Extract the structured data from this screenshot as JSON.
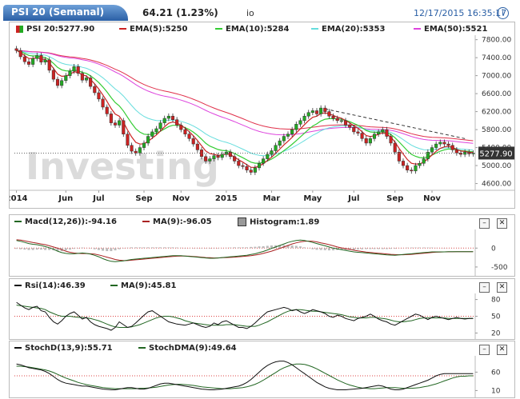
{
  "header": {
    "tab_label": "PSI 20 (Semanal)",
    "quote": "64.21 (1.23%)",
    "symbol_extra": "io",
    "timestamp": "12/17/2015 16:35:17",
    "info_icon": "info-icon"
  },
  "watermark": "Investing",
  "colors": {
    "up": "#22aa22",
    "down": "#cc2222",
    "ema5": "#cc2222",
    "ema10": "#33cc33",
    "ema20": "#66dddd",
    "ema50": "#dd44dd",
    "ema200": "#e0304a"
  },
  "price_panel": {
    "legend": [
      {
        "label": "PSI 20:5277.90",
        "color": "#cc2222",
        "icon": "candlestick-icon"
      },
      {
        "label": "EMA(5):5250",
        "color": "#cc2222"
      },
      {
        "label": "EMA(10):5284",
        "color": "#33cc33"
      },
      {
        "label": "EMA(20):5353",
        "color": "#66dddd"
      },
      {
        "label": "EMA(50):5521",
        "color": "#dd44dd"
      }
    ],
    "last_price_label": "5277.90"
  },
  "macd_panel": {
    "legend": [
      {
        "label": "Macd(12,26)):-94.16",
        "color": "#226622"
      },
      {
        "label": "MA(9):-96.05",
        "color": "#aa2222"
      },
      {
        "label": "Histogram:1.89",
        "color": "#999999"
      }
    ]
  },
  "rsi_panel": {
    "legend": [
      {
        "label": "Rsi(14):46.39",
        "color": "#111111"
      },
      {
        "label": "MA(9):45.81",
        "color": "#226622"
      }
    ]
  },
  "stoch_panel": {
    "legend": [
      {
        "label": "StochD(13,9):55.71",
        "color": "#111111"
      },
      {
        "label": "StochDMA(9):49.64",
        "color": "#226622"
      }
    ]
  },
  "panel_buttons": {
    "minimize": "–",
    "close": "✕"
  },
  "chart_data": [
    {
      "type": "candlestick",
      "title": "PSI 20 (Semanal)",
      "x_ticks": [
        "2014",
        "Jun",
        "Jul",
        "Sep",
        "Nov",
        "2015",
        "Mar",
        "May",
        "Jul",
        "Sep",
        "Nov"
      ],
      "y_ticks": [
        4600,
        5000,
        5400,
        5800,
        6200,
        6600,
        7000,
        7400,
        7800
      ],
      "ylim": [
        4450,
        7900
      ],
      "close": [
        7560,
        7420,
        7310,
        7250,
        7380,
        7450,
        7300,
        7350,
        7120,
        6920,
        6780,
        6890,
        7000,
        7100,
        7200,
        7050,
        6900,
        6950,
        6760,
        6620,
        6480,
        6300,
        6150,
        5950,
        5900,
        6000,
        5700,
        5450,
        5320,
        5280,
        5400,
        5500,
        5650,
        5750,
        5820,
        5950,
        6050,
        6100,
        6020,
        5900,
        5800,
        5700,
        5600,
        5480,
        5350,
        5200,
        5100,
        5150,
        5220,
        5180,
        5250,
        5300,
        5200,
        5100,
        5000,
        4980,
        4900,
        4850,
        4950,
        5050,
        5150,
        5250,
        5330,
        5450,
        5550,
        5650,
        5700,
        5800,
        5920,
        6000,
        6100,
        6180,
        6220,
        6150,
        6280,
        6200,
        6100,
        6050,
        6000,
        6000,
        5900,
        5850,
        5750,
        5720,
        5600,
        5500,
        5600,
        5700,
        5750,
        5800,
        5650,
        5500,
        5300,
        5100,
        5000,
        4900,
        4880,
        5000,
        5050,
        5150,
        5300,
        5400,
        5480,
        5520,
        5480,
        5450,
        5350,
        5280,
        5250,
        5300,
        5260,
        5278
      ],
      "open": [
        7600,
        7560,
        7420,
        7310,
        7250,
        7380,
        7450,
        7300,
        7350,
        7120,
        6920,
        6780,
        6890,
        7000,
        7100,
        7200,
        7050,
        6900,
        6950,
        6760,
        6620,
        6480,
        6300,
        6150,
        5950,
        5900,
        6000,
        5700,
        5450,
        5320,
        5280,
        5400,
        5500,
        5650,
        5750,
        5820,
        5950,
        6050,
        6100,
        6020,
        5900,
        5800,
        5700,
        5600,
        5480,
        5350,
        5200,
        5100,
        5150,
        5220,
        5180,
        5250,
        5300,
        5200,
        5100,
        5000,
        4980,
        4900,
        4850,
        4950,
        5050,
        5150,
        5250,
        5330,
        5450,
        5550,
        5650,
        5700,
        5800,
        5920,
        6000,
        6100,
        6180,
        6220,
        6150,
        6280,
        6200,
        6100,
        6050,
        6000,
        6000,
        5900,
        5850,
        5750,
        5720,
        5600,
        5500,
        5600,
        5700,
        5750,
        5800,
        5650,
        5500,
        5300,
        5100,
        5000,
        4900,
        4880,
        5000,
        5050,
        5150,
        5300,
        5400,
        5480,
        5520,
        5480,
        5450,
        5350,
        5280,
        5250,
        5300,
        5260
      ],
      "series": [
        {
          "name": "EMA(5)",
          "color": "#cc2222"
        },
        {
          "name": "EMA(10)",
          "color": "#33cc33"
        },
        {
          "name": "EMA(20)",
          "color": "#66dddd"
        },
        {
          "name": "EMA(50)",
          "color": "#dd44dd"
        }
      ]
    },
    {
      "type": "line",
      "title": "Macd(12,26))",
      "y_ticks": [
        0,
        -500
      ],
      "ylim": [
        -650,
        450
      ],
      "macd": [
        200,
        180,
        150,
        120,
        100,
        90,
        70,
        40,
        10,
        -30,
        -80,
        -120,
        -140,
        -150,
        -150,
        -140,
        -130,
        -140,
        -160,
        -190,
        -230,
        -280,
        -320,
        -350,
        -360,
        -350,
        -340,
        -320,
        -300,
        -290,
        -280,
        -270,
        -260,
        -250,
        -240,
        -230,
        -220,
        -210,
        -200,
        -200,
        -200,
        -210,
        -220,
        -230,
        -240,
        -250,
        -260,
        -270,
        -270,
        -260,
        -250,
        -240,
        -230,
        -220,
        -210,
        -200,
        -190,
        -170,
        -150,
        -120,
        -90,
        -50,
        -10,
        30,
        70,
        110,
        150,
        180,
        200,
        210,
        200,
        180,
        150,
        120,
        90,
        60,
        30,
        0,
        -20,
        -40,
        -60,
        -80,
        -100,
        -110,
        -120,
        -130,
        -140,
        -150,
        -160,
        -170,
        -180,
        -185,
        -190,
        -180,
        -170,
        -160,
        -150,
        -140,
        -130,
        -120,
        -110,
        -100,
        -100,
        -100,
        -100,
        -95,
        -95,
        -94,
        -94,
        -94,
        -94,
        -94
      ],
      "signal": [
        220,
        210,
        190,
        170,
        150,
        130,
        110,
        90,
        60,
        30,
        0,
        -40,
        -80,
        -110,
        -130,
        -140,
        -145,
        -145,
        -150,
        -160,
        -180,
        -210,
        -240,
        -270,
        -300,
        -320,
        -330,
        -330,
        -320,
        -310,
        -300,
        -290,
        -280,
        -270,
        -260,
        -250,
        -240,
        -230,
        -220,
        -215,
        -210,
        -210,
        -215,
        -220,
        -230,
        -240,
        -250,
        -255,
        -260,
        -260,
        -255,
        -250,
        -245,
        -240,
        -230,
        -220,
        -210,
        -200,
        -185,
        -165,
        -140,
        -110,
        -80,
        -45,
        -10,
        30,
        70,
        110,
        140,
        165,
        180,
        185,
        180,
        165,
        140,
        115,
        90,
        60,
        30,
        5,
        -15,
        -35,
        -55,
        -75,
        -90,
        -105,
        -115,
        -125,
        -135,
        -145,
        -155,
        -165,
        -172,
        -176,
        -176,
        -172,
        -165,
        -155,
        -145,
        -135,
        -125,
        -115,
        -108,
        -104,
        -100,
        -98,
        -97,
        -96,
        -96,
        -96,
        -96,
        -96
      ]
    },
    {
      "type": "line",
      "title": "Rsi(14)",
      "y_ticks": [
        80,
        50,
        20
      ],
      "ylim": [
        15,
        88
      ],
      "rsi": [
        75,
        70,
        65,
        62,
        66,
        68,
        60,
        58,
        48,
        40,
        36,
        42,
        50,
        55,
        58,
        52,
        45,
        48,
        40,
        35,
        32,
        30,
        28,
        25,
        30,
        40,
        35,
        30,
        32,
        38,
        45,
        52,
        58,
        60,
        55,
        50,
        45,
        40,
        38,
        36,
        35,
        34,
        36,
        38,
        35,
        32,
        30,
        32,
        38,
        35,
        40,
        42,
        38,
        34,
        30,
        30,
        28,
        32,
        38,
        45,
        52,
        58,
        60,
        62,
        64,
        66,
        64,
        60,
        62,
        58,
        55,
        58,
        62,
        60,
        58,
        55,
        50,
        48,
        52,
        50,
        46,
        44,
        42,
        46,
        48,
        50,
        54,
        50,
        45,
        42,
        40,
        36,
        34,
        38,
        42,
        46,
        50,
        54,
        52,
        48,
        44,
        48,
        50,
        48,
        46,
        44,
        46,
        48,
        46,
        45,
        46,
        46
      ],
      "ma": [
        70,
        69,
        68,
        67,
        66,
        65,
        64,
        62,
        58,
        55,
        52,
        50,
        50,
        50,
        49,
        48,
        48,
        47,
        46,
        44,
        42,
        39,
        36,
        33,
        31,
        30,
        30,
        30,
        31,
        33,
        35,
        38,
        41,
        44,
        47,
        49,
        50,
        50,
        49,
        47,
        45,
        42,
        40,
        38,
        37,
        36,
        35,
        34,
        34,
        34,
        34,
        35,
        35,
        35,
        34,
        33,
        32,
        32,
        32,
        34,
        37,
        40,
        44,
        48,
        52,
        56,
        59,
        61,
        62,
        62,
        61,
        60,
        59,
        59,
        58,
        57,
        56,
        55,
        54,
        53,
        51,
        49,
        48,
        47,
        47,
        47,
        48,
        48,
        47,
        46,
        45,
        43,
        41,
        40,
        40,
        41,
        42,
        44,
        46,
        47,
        47,
        47,
        47,
        47,
        47,
        46,
        46,
        46,
        46,
        46,
        46,
        46
      ]
    },
    {
      "type": "line",
      "title": "StochD(13,9)",
      "y_ticks": [
        60,
        10
      ],
      "ylim": [
        0,
        100
      ],
      "stochd": [
        82,
        80,
        76,
        72,
        70,
        68,
        66,
        62,
        56,
        48,
        40,
        34,
        30,
        28,
        26,
        24,
        22,
        22,
        20,
        18,
        16,
        14,
        13,
        12,
        12,
        14,
        16,
        18,
        18,
        16,
        14,
        14,
        16,
        20,
        24,
        28,
        30,
        30,
        28,
        26,
        24,
        22,
        20,
        18,
        16,
        14,
        13,
        12,
        12,
        13,
        14,
        16,
        18,
        20,
        22,
        26,
        32,
        40,
        50,
        60,
        70,
        78,
        84,
        88,
        90,
        90,
        86,
        80,
        72,
        64,
        56,
        48,
        40,
        32,
        26,
        20,
        16,
        14,
        12,
        12,
        12,
        13,
        14,
        15,
        16,
        18,
        20,
        22,
        24,
        22,
        18,
        14,
        12,
        12,
        14,
        18,
        22,
        26,
        30,
        34,
        38,
        44,
        50,
        54,
        56,
        56,
        56,
        56,
        56,
        56,
        56,
        56
      ],
      "ma": [
        76,
        76,
        75,
        74,
        72,
        70,
        68,
        66,
        63,
        59,
        54,
        49,
        44,
        40,
        36,
        32,
        29,
        26,
        24,
        22,
        20,
        18,
        17,
        16,
        15,
        15,
        15,
        15,
        15,
        15,
        16,
        16,
        17,
        18,
        19,
        21,
        23,
        25,
        26,
        27,
        27,
        26,
        25,
        24,
        22,
        20,
        19,
        18,
        17,
        16,
        15,
        15,
        15,
        16,
        17,
        18,
        20,
        23,
        27,
        32,
        38,
        45,
        52,
        59,
        66,
        72,
        76,
        80,
        82,
        82,
        81,
        78,
        74,
        69,
        63,
        57,
        51,
        45,
        39,
        34,
        29,
        25,
        22,
        19,
        17,
        16,
        15,
        15,
        16,
        17,
        18,
        18,
        18,
        17,
        16,
        16,
        16,
        17,
        18,
        20,
        22,
        25,
        28,
        32,
        36,
        40,
        44,
        47,
        49,
        49,
        50,
        50
      ]
    }
  ]
}
